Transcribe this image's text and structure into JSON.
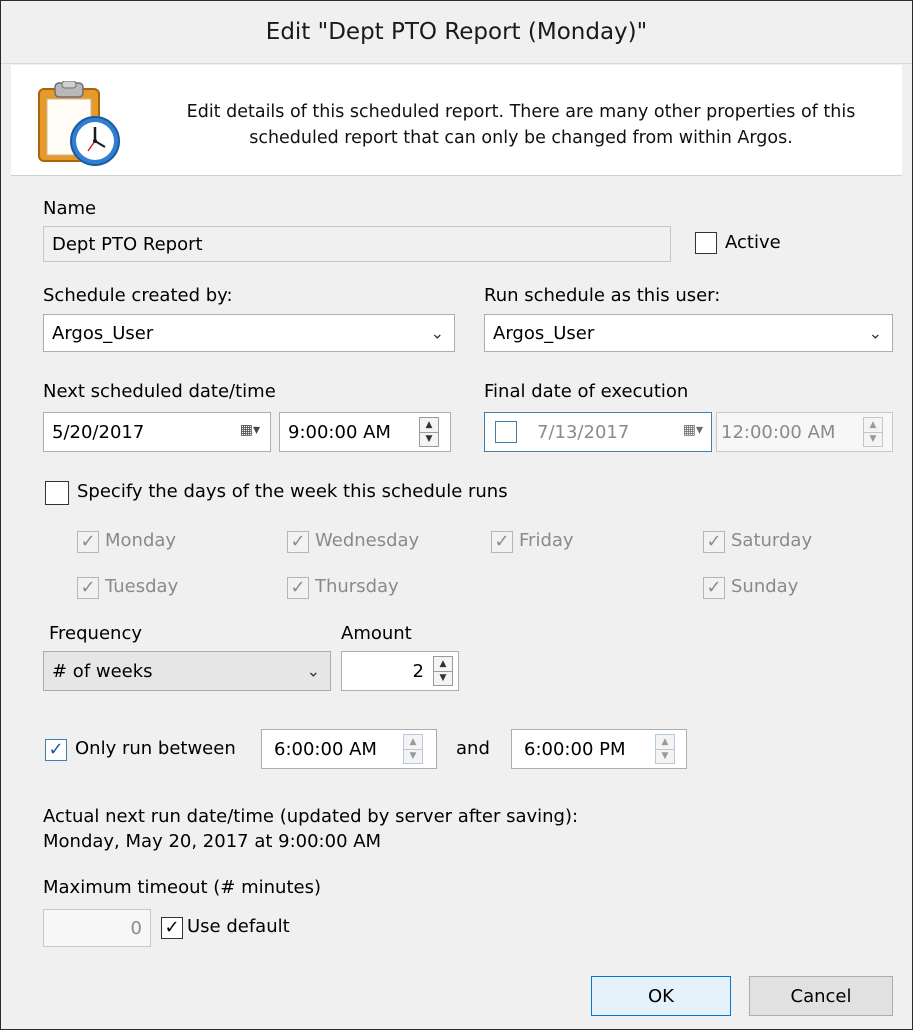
{
  "dialog": {
    "title": "Edit \"Dept PTO Report (Monday)\"",
    "header_line1": "Edit details of this scheduled report.  There are many other properties of this",
    "header_line2": "scheduled report that can only be changed from within Argos.",
    "header_icon": "clipboard-clock-icon"
  },
  "name": {
    "label": "Name",
    "value": "Dept PTO Report",
    "active_label": "Active",
    "active_checked": false
  },
  "created_by": {
    "label": "Schedule created by:",
    "value": "Argos_User"
  },
  "run_as": {
    "label": "Run schedule as this user:",
    "value": "Argos_User"
  },
  "next_scheduled": {
    "label": "Next scheduled date/time",
    "date": "5/20/2017",
    "time": "9:00:00 AM"
  },
  "final_date": {
    "label": "Final date of execution",
    "enabled": false,
    "date": "7/13/2017",
    "time": "12:00:00 AM"
  },
  "days": {
    "specify_label": "Specify the days of the week this schedule runs",
    "specify_checked": false,
    "monday": "Monday",
    "tuesday": "Tuesday",
    "wednesday": "Wednesday",
    "thursday": "Thursday",
    "friday": "Friday",
    "saturday": "Saturday",
    "sunday": "Sunday"
  },
  "frequency": {
    "label": "Frequency",
    "value": "# of weeks"
  },
  "amount": {
    "label": "Amount",
    "value": "2"
  },
  "only_run": {
    "label": "Only run between",
    "checked": true,
    "start": "6:00:00 AM",
    "and_label": "and",
    "end": "6:00:00 PM"
  },
  "next_run": {
    "label": "Actual next run date/time (updated by server after saving):",
    "value": "Monday, May 20, 2017 at 9:00:00 AM"
  },
  "timeout": {
    "label": "Maximum timeout (# minutes)",
    "value": "0",
    "use_default_label": "Use default",
    "use_default_checked": true
  },
  "buttons": {
    "ok": "OK",
    "cancel": "Cancel"
  },
  "colors": {
    "accent": "#0078d7",
    "dialog_bg": "#f0f0f0",
    "header_bg": "#ffffff"
  }
}
